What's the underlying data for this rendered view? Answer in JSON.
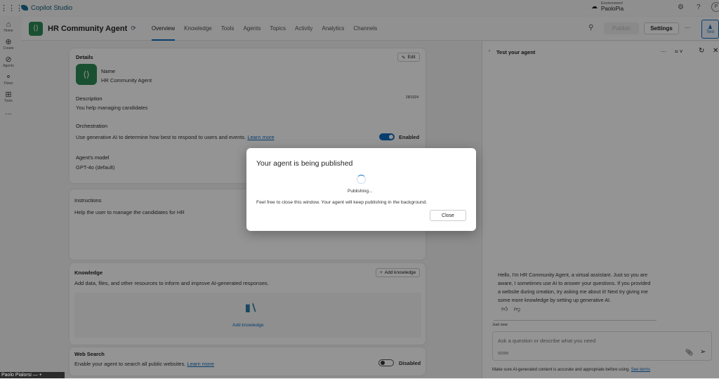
{
  "app": {
    "title": "Copilot Studio",
    "environment_label": "Environment",
    "environment": "PaoloPia",
    "avatar_initial": "P"
  },
  "nav": [
    {
      "label": "Home",
      "icon": "home-icon"
    },
    {
      "label": "Create",
      "icon": "plus-circle-icon"
    },
    {
      "label": "Agents",
      "icon": "agents-icon"
    },
    {
      "label": "Flows",
      "icon": "flows-icon"
    },
    {
      "label": "Tools",
      "icon": "tools-icon"
    },
    {
      "label": "...",
      "icon": "more-icon"
    }
  ],
  "header": {
    "agent_name": "HR Community Agent",
    "tabs": [
      "Overview",
      "Knowledge",
      "Tools",
      "Agents",
      "Topics",
      "Activity",
      "Analytics",
      "Channels"
    ],
    "active_tab": "Overview",
    "publish": "Publish",
    "settings": "Settings",
    "more": "···",
    "test": "Test"
  },
  "details": {
    "title": "Details",
    "edit": "Edit",
    "name_label": "Name",
    "name": "HR Community Agent",
    "description_label": "Description",
    "description": "You help managing candidates",
    "char_count": "28/1024",
    "orchestration_label": "Orchestration",
    "orchestration_text": "Use generative AI to determine how best to respond to users and events.",
    "learn_more": "Learn more",
    "orchestration_state": "Enabled",
    "model_label": "Agent's model",
    "model": "GPT-4o (default)"
  },
  "instructions": {
    "title": "Instructions",
    "text": "Help the user to manage the candidates for HR"
  },
  "knowledge": {
    "title": "Knowledge",
    "add_button": "Add knowledge",
    "text": "Add data, files, and other resources to inform and improve AI-generated responses.",
    "empty_link": "Add knowledge"
  },
  "web_search": {
    "title": "Web Search",
    "text": "Enable your agent to search all public websites.",
    "learn_more": "Learn more",
    "state": "Disabled"
  },
  "test_panel": {
    "title": "Test your agent",
    "message": "Hello, I'm HR Community Agent, a virtual assistant. Just so you are aware, I sometimes use AI to answer your questions. If you provided a website during creation, try asking me about it! Next try giving me some more knowledge by setting up generative AI.",
    "timestamp": "Just now",
    "input_placeholder": "Ask a question or describe what you need",
    "char_count": "0/2000",
    "disclaimer": "Make sure AI-generated content is accurate and appropriate before using.",
    "see_terms": "See terms"
  },
  "dialog": {
    "title": "Your agent is being published",
    "status": "Publishing...",
    "message": "Feel free to close this window. Your agent will keep publishing in the background.",
    "close": "Close"
  },
  "taskbar": {
    "label": "Paolo Pialorsi  —  +"
  }
}
